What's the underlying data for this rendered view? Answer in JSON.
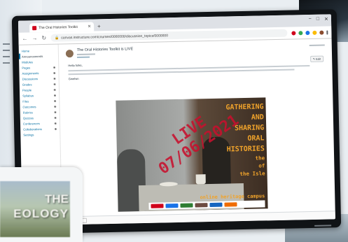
{
  "browser": {
    "tab_title": "The Oral Histories Toolkit",
    "new_tab": "+",
    "window_controls": [
      "−",
      "□",
      "✕"
    ],
    "url": "canvas.instructure.com/courses/0000000/discussion_topics/0000000",
    "extension_colors": [
      "#d0021b",
      "#34a853",
      "#1a73e8",
      "#fbbc05",
      "#5f6368"
    ]
  },
  "course_nav": {
    "items": [
      {
        "label": "Home"
      },
      {
        "label": "Announcements"
      },
      {
        "label": "Modules"
      },
      {
        "label": "Pages"
      },
      {
        "label": "Assignments"
      },
      {
        "label": "Discussions"
      },
      {
        "label": "Grades"
      },
      {
        "label": "People"
      },
      {
        "label": "Syllabus"
      },
      {
        "label": "Files"
      },
      {
        "label": "Outcomes"
      },
      {
        "label": "Rubrics"
      },
      {
        "label": "Quizzes"
      },
      {
        "label": "Conferences"
      },
      {
        "label": "Collaborations"
      },
      {
        "label": "Settings"
      }
    ]
  },
  "post": {
    "title": "The Oral Histories Toolkit is LIVE",
    "edit_label": "✎ Edit",
    "greeting": "Hello folks,",
    "signoff": "Gwelwn"
  },
  "poster": {
    "gathering": "GATHERING",
    "and": "AND",
    "sharing": "SHARING",
    "oral": "ORAL",
    "histories": "HISTORIES",
    "line6": "the",
    "line7": "of",
    "isle": "the Isle",
    "footer": "online heritage campus",
    "live_word": "LIVE",
    "live_date": "07/06/2021",
    "logo_colors": [
      "#d0021b",
      "#1a73e8",
      "#2e7d32",
      "#6d4c41",
      "#1565c0",
      "#ef6c00"
    ]
  },
  "foreground": {
    "word1": "THE",
    "word2": "EOLOGY"
  },
  "colors": {
    "canvas_link": "#0770a3",
    "live_red": "#c8102e",
    "poster_orange": "#f0a32b"
  }
}
